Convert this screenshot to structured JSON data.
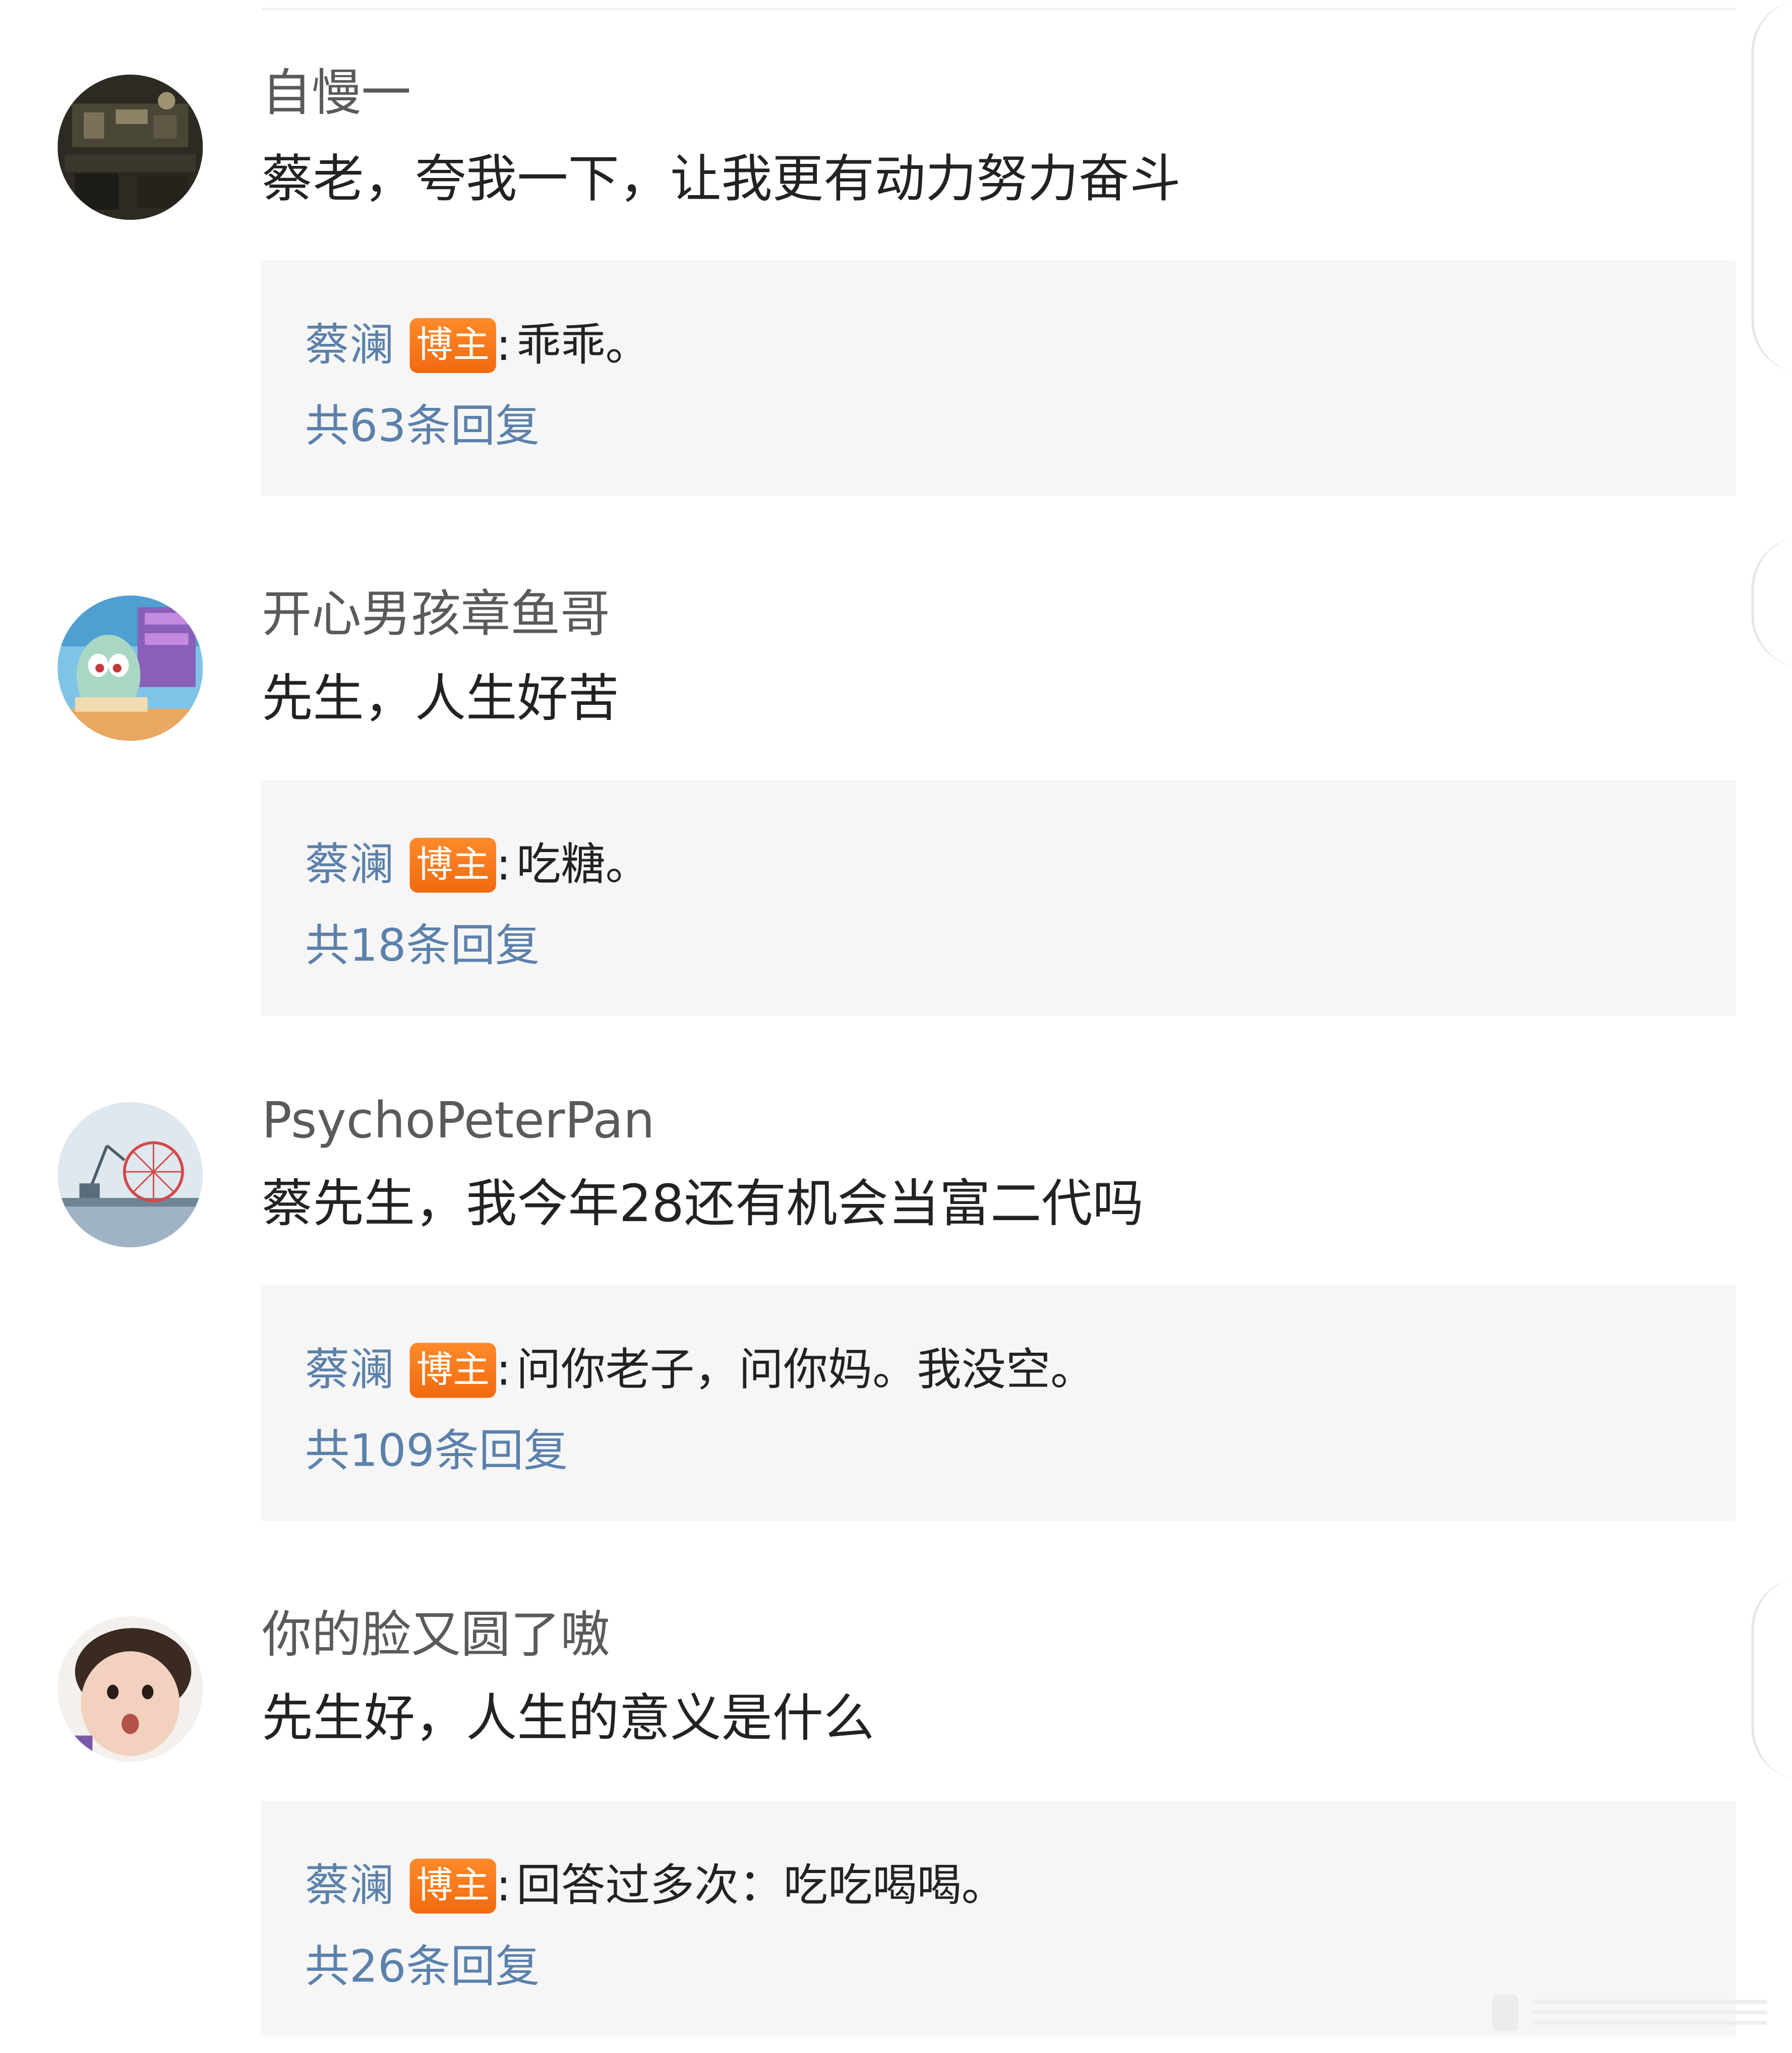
{
  "comments": [
    {
      "username": "自慢一",
      "text": "蔡老，夸我一下，让我更有动力努力奋斗",
      "reply": {
        "author": "蔡澜",
        "badge": "博主",
        "text": "乖乖。",
        "count": "共63条回复"
      },
      "avatar": "dark-room-photo"
    },
    {
      "username": "开心男孩章鱼哥",
      "text": "先生，人生好苦",
      "reply": {
        "author": "蔡澜",
        "badge": "博主",
        "text": "吃糖。",
        "count": "共18条回复"
      },
      "avatar": "cartoon-squid-character"
    },
    {
      "username": "PsychoPeterPan",
      "text": "蔡先生，我今年28还有机会当富二代吗",
      "reply": {
        "author": "蔡澜",
        "badge": "博主",
        "text": "问你老子，问你妈。我没空。",
        "count": "共109条回复"
      },
      "avatar": "ferris-wheel-harbor"
    },
    {
      "username": "你的脸又圆了嗷",
      "text": "先生好，人生的意义是什么",
      "reply": {
        "author": "蔡澜",
        "badge": "博主",
        "text": "回答过多次：吃吃喝喝。",
        "count": "共26条回复"
      },
      "avatar": "child-face-photo"
    }
  ],
  "colors": {
    "link_blue": "#5b81ab",
    "badge_orange": "#f36f14",
    "reply_bg": "#f6f6f6",
    "username_gray": "#5a5a5a",
    "text_dark": "#222222"
  }
}
